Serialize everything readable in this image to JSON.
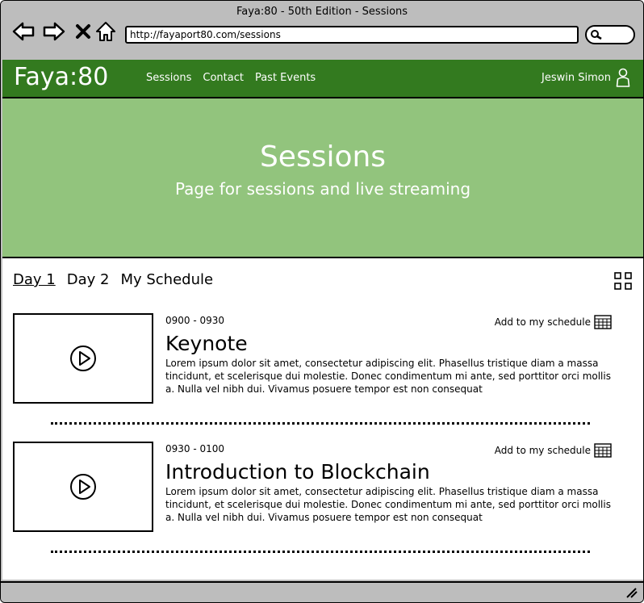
{
  "window": {
    "title": "Faya:80 - 50th Edition - Sessions"
  },
  "browser": {
    "url": "http://fayaport80.com/sessions"
  },
  "header": {
    "brand": "Faya:80",
    "nav": [
      "Sessions",
      "Contact",
      "Past Events"
    ],
    "user_name": "Jeswin Simon"
  },
  "hero": {
    "title": "Sessions",
    "subtitle": "Page for sessions and live streaming"
  },
  "tabs": [
    {
      "label": "Day 1",
      "active": true
    },
    {
      "label": "Day 2",
      "active": false
    },
    {
      "label": "My Schedule",
      "active": false
    }
  ],
  "sessions": [
    {
      "time": "0900 - 0930",
      "title": "Keynote",
      "description": "Lorem ipsum dolor sit amet, consectetur adipiscing elit. Phasellus tristique diam a massa tincidunt, et scelerisque dui molestie. Donec condimentum mi ante, sed porttitor orci mollis a. Nulla vel nibh dui. Vivamus posuere tempor est non consequat",
      "add_label": "Add to my schedule"
    },
    {
      "time": "0930 - 0100",
      "title": "Introduction to Blockchain",
      "description": "Lorem ipsum dolor sit amet, consectetur adipiscing elit. Phasellus tristique diam a massa tincidunt, et scelerisque dui molestie. Donec condimentum mi ante, sed porttitor orci mollis a. Nulla vel nibh dui. Vivamus posuere tempor est non consequat",
      "add_label": "Add to my schedule"
    }
  ],
  "colors": {
    "navbar": "#337a1f",
    "hero": "#92c47d",
    "chrome": "#bdbdbd"
  },
  "icons": [
    "back-icon",
    "forward-icon",
    "close-icon",
    "home-icon",
    "search-icon",
    "user-icon",
    "grid-view-icon",
    "play-icon",
    "calendar-table-icon",
    "resize-grip-icon"
  ]
}
